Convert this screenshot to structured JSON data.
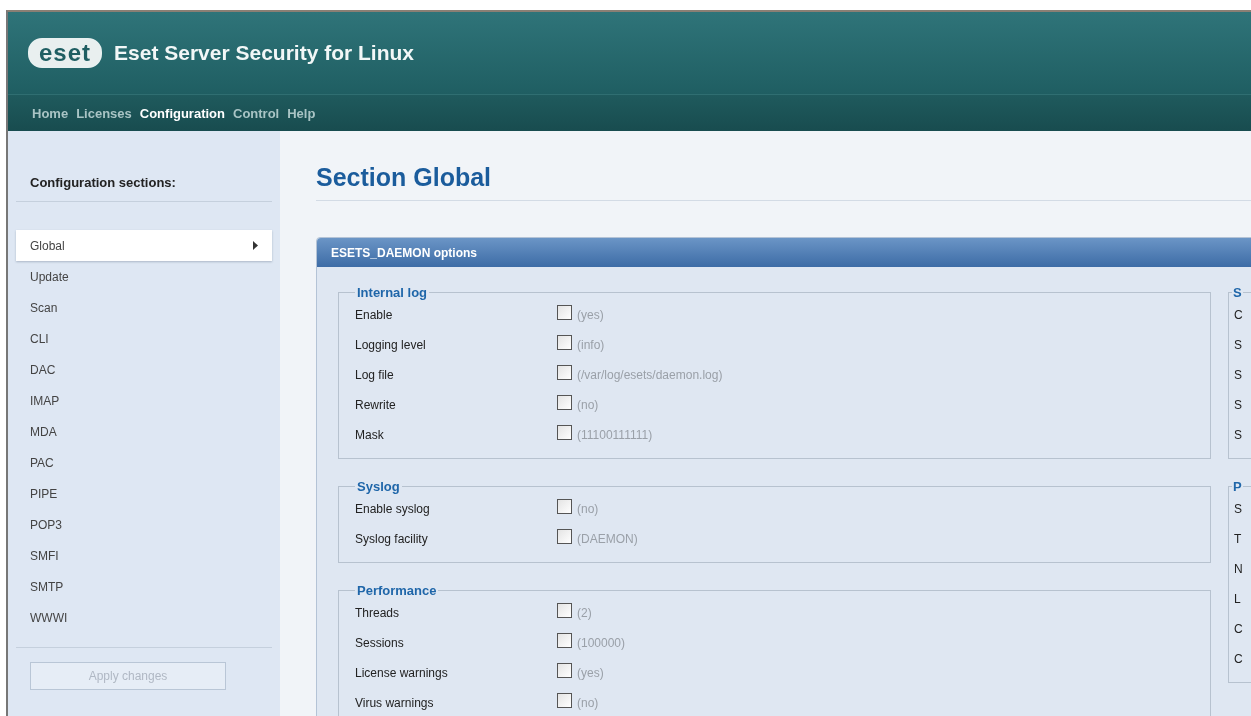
{
  "header": {
    "logo": "eset",
    "title": "Eset Server Security for Linux"
  },
  "nav": [
    {
      "label": "Home",
      "selected": false
    },
    {
      "label": "Licenses",
      "selected": false
    },
    {
      "label": "Configuration",
      "selected": true
    },
    {
      "label": "Control",
      "selected": false
    },
    {
      "label": "Help",
      "selected": false
    }
  ],
  "sidebar": {
    "heading": "Configuration sections:",
    "items": [
      {
        "label": "Global",
        "selected": true
      },
      {
        "label": "Update",
        "selected": false
      },
      {
        "label": "Scan",
        "selected": false
      },
      {
        "label": "CLI",
        "selected": false
      },
      {
        "label": "DAC",
        "selected": false
      },
      {
        "label": "IMAP",
        "selected": false
      },
      {
        "label": "MDA",
        "selected": false
      },
      {
        "label": "PAC",
        "selected": false
      },
      {
        "label": "PIPE",
        "selected": false
      },
      {
        "label": "POP3",
        "selected": false
      },
      {
        "label": "SMFI",
        "selected": false
      },
      {
        "label": "SMTP",
        "selected": false
      },
      {
        "label": "WWWI",
        "selected": false
      }
    ],
    "apply_button": {
      "label": "Apply changes",
      "disabled": true
    }
  },
  "page_title": "Section Global",
  "panel": {
    "title": "ESETS_DAEMON options",
    "left_groups": [
      {
        "title": "Internal log",
        "rows": [
          {
            "label": "Enable",
            "checked": false,
            "default": "(yes)"
          },
          {
            "label": "Logging level",
            "checked": false,
            "default": "(info)"
          },
          {
            "label": "Log file",
            "checked": false,
            "default": "(/var/log/esets/daemon.log)"
          },
          {
            "label": "Rewrite",
            "checked": false,
            "default": "(no)"
          },
          {
            "label": "Mask",
            "checked": false,
            "default": "(11100111111)"
          }
        ]
      },
      {
        "title": "Syslog",
        "rows": [
          {
            "label": "Enable syslog",
            "checked": false,
            "default": "(no)"
          },
          {
            "label": "Syslog facility",
            "checked": false,
            "default": "(DAEMON)"
          }
        ]
      },
      {
        "title": "Performance",
        "rows": [
          {
            "label": "Threads",
            "checked": false,
            "default": "(2)"
          },
          {
            "label": "Sessions",
            "checked": false,
            "default": "(100000)"
          },
          {
            "label": "License warnings",
            "checked": false,
            "default": "(yes)"
          },
          {
            "label": "Virus warnings",
            "checked": false,
            "default": "(no)"
          }
        ]
      }
    ],
    "right_groups": [
      {
        "title": "S",
        "rows": [
          "C",
          "S",
          "S",
          "S",
          "S"
        ]
      },
      {
        "title": "P",
        "rows": [
          "S",
          "T",
          "N",
          "L",
          "C",
          "C"
        ]
      }
    ]
  }
}
